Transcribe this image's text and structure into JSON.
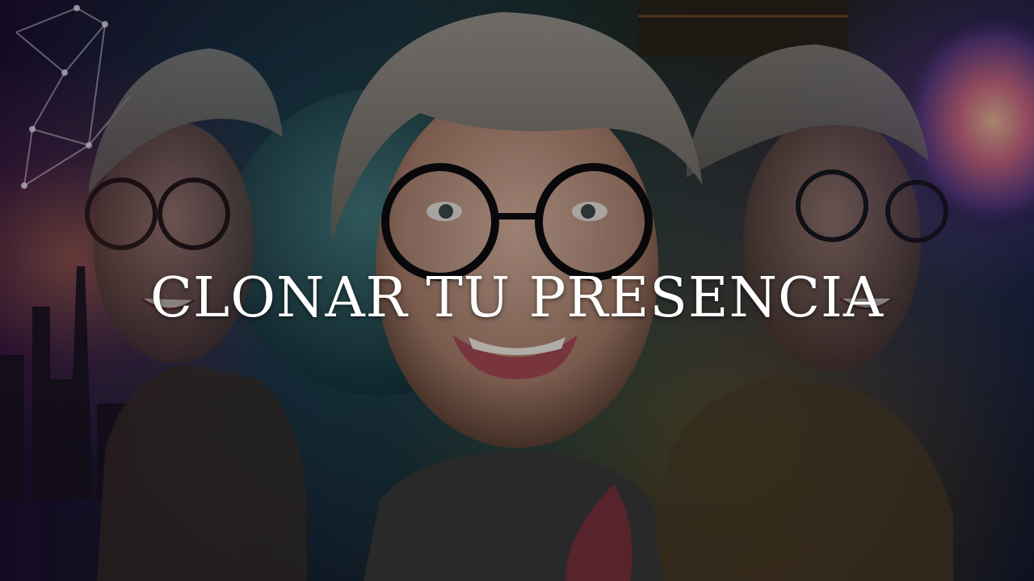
{
  "title": "CLONAR TU PRESENCIA"
}
